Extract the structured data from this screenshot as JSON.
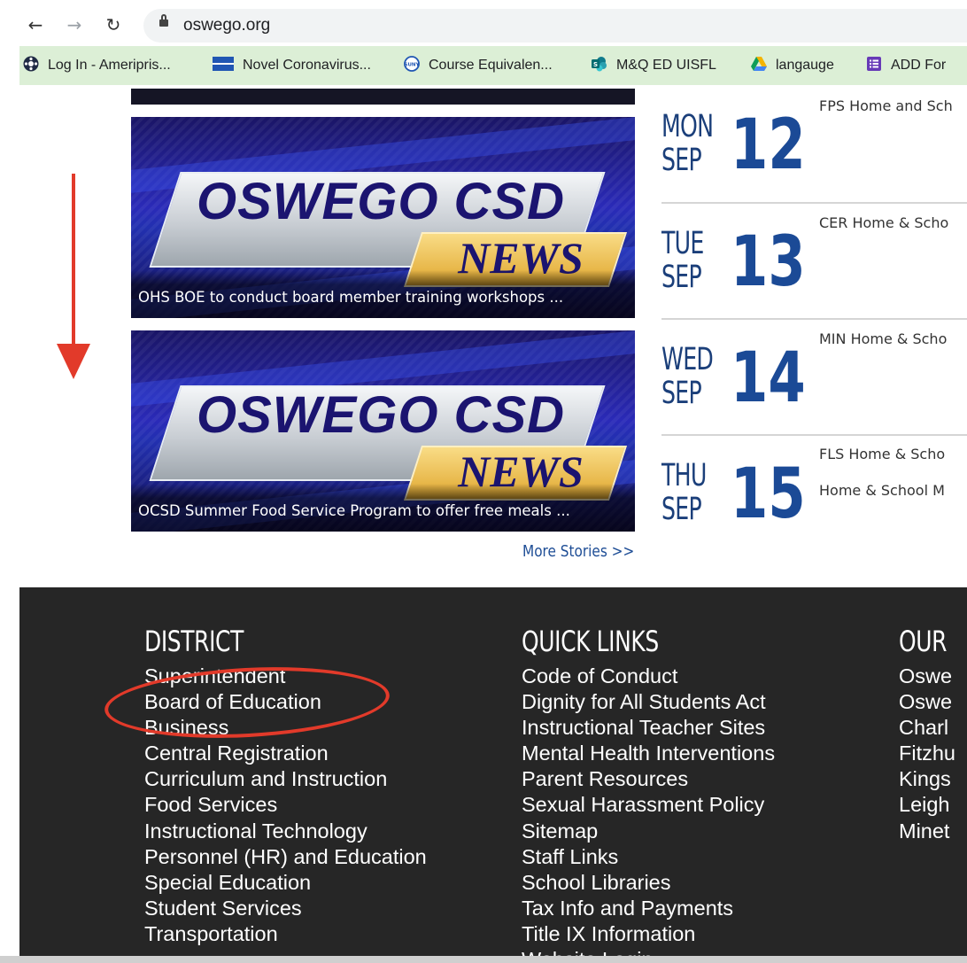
{
  "browser": {
    "url": "oswego.org",
    "bookmarks": [
      {
        "label": "Log In - Ameripris...",
        "icon": "gear-badge-icon",
        "color": "#1f2a44"
      },
      {
        "label": "Novel Coronavirus...",
        "icon": "flag-icon",
        "color": "#2056b3"
      },
      {
        "label": "Course Equivalen...",
        "icon": "suny-icon",
        "color": "#2056b3"
      },
      {
        "label": "M&Q ED UISFL",
        "icon": "sharepoint-icon",
        "color": "#0f7b8c"
      },
      {
        "label": "langauge",
        "icon": "google-drive-icon",
        "color": "#f4b400"
      },
      {
        "label": "ADD For",
        "icon": "forms-icon",
        "color": "#673ab7"
      }
    ]
  },
  "news": [
    {
      "logo_title": "OSWEGO CSD",
      "logo_tag": "NEWS",
      "caption": "OHS BOE to conduct board member training workshops ..."
    },
    {
      "logo_title": "OSWEGO CSD",
      "logo_tag": "NEWS",
      "caption": "OCSD Summer Food Service Program to offer free meals ..."
    }
  ],
  "more_stories": "More Stories >>",
  "events": [
    {
      "day": "MON",
      "month": "SEP",
      "date": "12",
      "items": [
        "FPS Home and Sch"
      ]
    },
    {
      "day": "TUE",
      "month": "SEP",
      "date": "13",
      "items": [
        "CER Home & Scho"
      ]
    },
    {
      "day": "WED",
      "month": "SEP",
      "date": "14",
      "items": [
        "MIN Home & Scho"
      ]
    },
    {
      "day": "THU",
      "month": "SEP",
      "date": "15",
      "items": [
        "FLS Home & Scho",
        "Home & School M"
      ]
    }
  ],
  "footer": {
    "district": {
      "heading": "DISTRICT",
      "links": [
        "Superintendent",
        "Board of Education",
        "Business",
        "Central Registration",
        "Curriculum and Instruction",
        "Food Services",
        "Instructional Technology",
        "Personnel (HR) and Education",
        "Special Education",
        "Student Services",
        "Transportation"
      ]
    },
    "quick_links": {
      "heading": "QUICK LINKS",
      "links": [
        "Code of Conduct",
        "Dignity for All Students Act",
        "Instructional Teacher Sites",
        "Mental Health Interventions",
        "Parent Resources",
        "Sexual Harassment Policy",
        "Sitemap",
        "Staff Links",
        "School Libraries",
        "Tax Info and Payments",
        "Title IX Information",
        "Website Login"
      ]
    },
    "our_schools": {
      "heading": "OUR",
      "links": [
        "Oswe",
        "Oswe",
        "Charl",
        "Fitzhu",
        "Kings",
        "Leigh",
        "Minet"
      ]
    }
  },
  "annotations": {
    "arrow_color": "#e23a2a",
    "highlight_color": "#e23a2a"
  }
}
